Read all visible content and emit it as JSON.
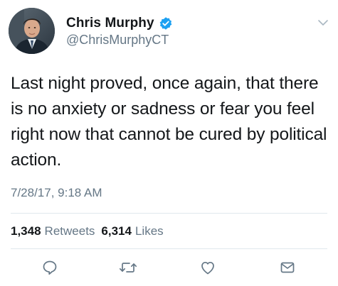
{
  "tweet": {
    "display_name": "Chris Murphy",
    "handle": "@ChrisMurphyCT",
    "verified": true,
    "text": "Last night proved, once again, that there is no anxiety or sadness or fear you feel right now that cannot be cured by political action.",
    "timestamp": "7/28/17, 9:18 AM",
    "stats": {
      "retweets_count": "1,348",
      "retweets_label": "Retweets",
      "likes_count": "6,314",
      "likes_label": "Likes"
    }
  },
  "actions": [
    {
      "icon": "reply-icon"
    },
    {
      "icon": "retweet-icon"
    },
    {
      "icon": "like-icon"
    },
    {
      "icon": "direct-message-icon"
    }
  ],
  "colors": {
    "text": "#14171a",
    "secondary": "#657786",
    "verified_blue": "#1da1f2",
    "divider": "#e1e8ed",
    "icon": "#657786"
  }
}
